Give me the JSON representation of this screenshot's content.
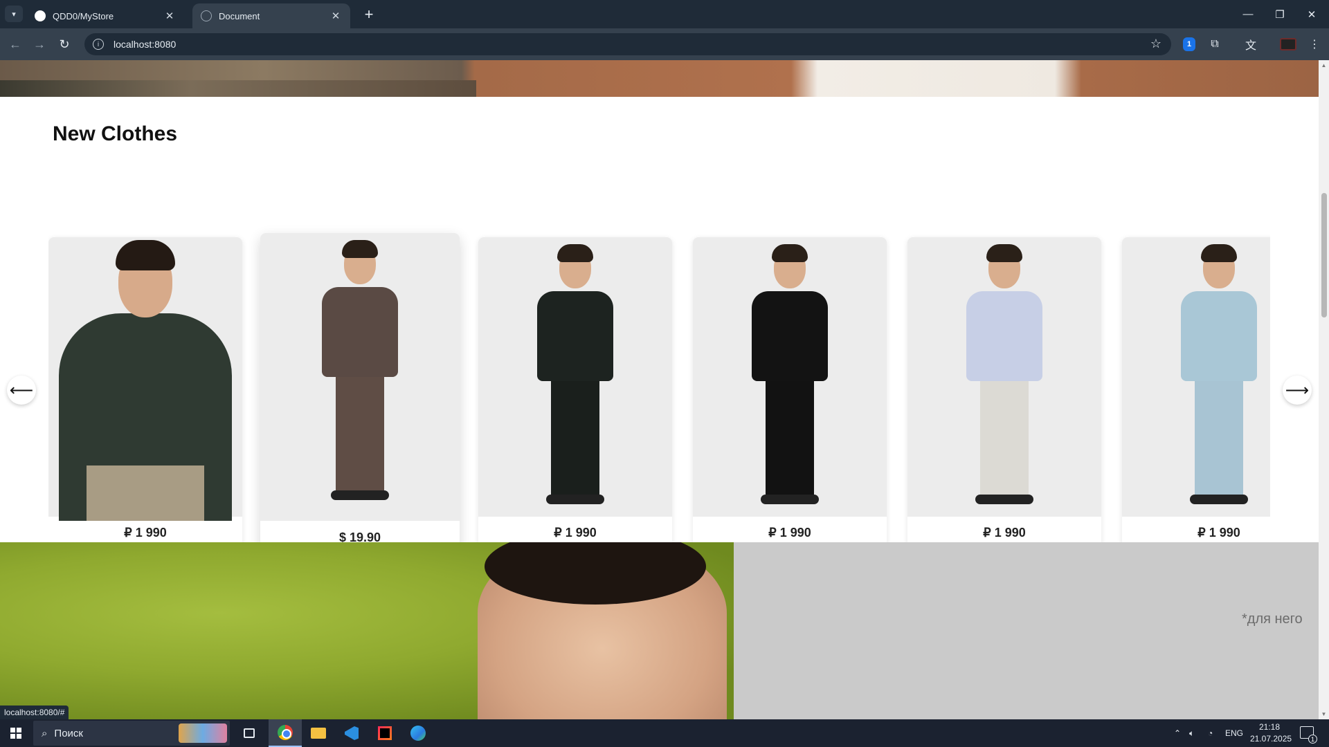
{
  "browser": {
    "tabs": [
      {
        "title": "QDD0/MyStore",
        "favicon": "github-icon",
        "active": false
      },
      {
        "title": "Document",
        "favicon": "globe-icon",
        "active": true
      }
    ],
    "address": "localhost:8080",
    "status_url": "localhost:8080/#"
  },
  "page": {
    "section_title": "New Clothes",
    "products": [
      {
        "price": "₽ 1 990",
        "top_color": "#2f3a32",
        "bottom_color": "#a89c84",
        "style": "closeup"
      },
      {
        "price": "$ 19.90",
        "top_color": "#5a4a44",
        "bottom_color": "#5f4d45",
        "style": "full"
      },
      {
        "price": "₽ 1 990",
        "top_color": "#1d2320",
        "bottom_color": "#1a1f1c",
        "style": "full"
      },
      {
        "price": "₽ 1 990",
        "top_color": "#131313",
        "bottom_color": "#121212",
        "style": "full"
      },
      {
        "price": "₽ 1 990",
        "top_color": "#c7cfe6",
        "bottom_color": "#dcdad4",
        "style": "full"
      },
      {
        "price": "₽ 1 990",
        "top_color": "#a9c7d6",
        "bottom_color": "#a8c4d3",
        "style": "full"
      }
    ],
    "banner_tag": "*для него"
  },
  "taskbar": {
    "search_placeholder": "Поиск",
    "language": "ENG",
    "time": "21:18",
    "date": "21.07.2025",
    "notification_count": "1"
  }
}
